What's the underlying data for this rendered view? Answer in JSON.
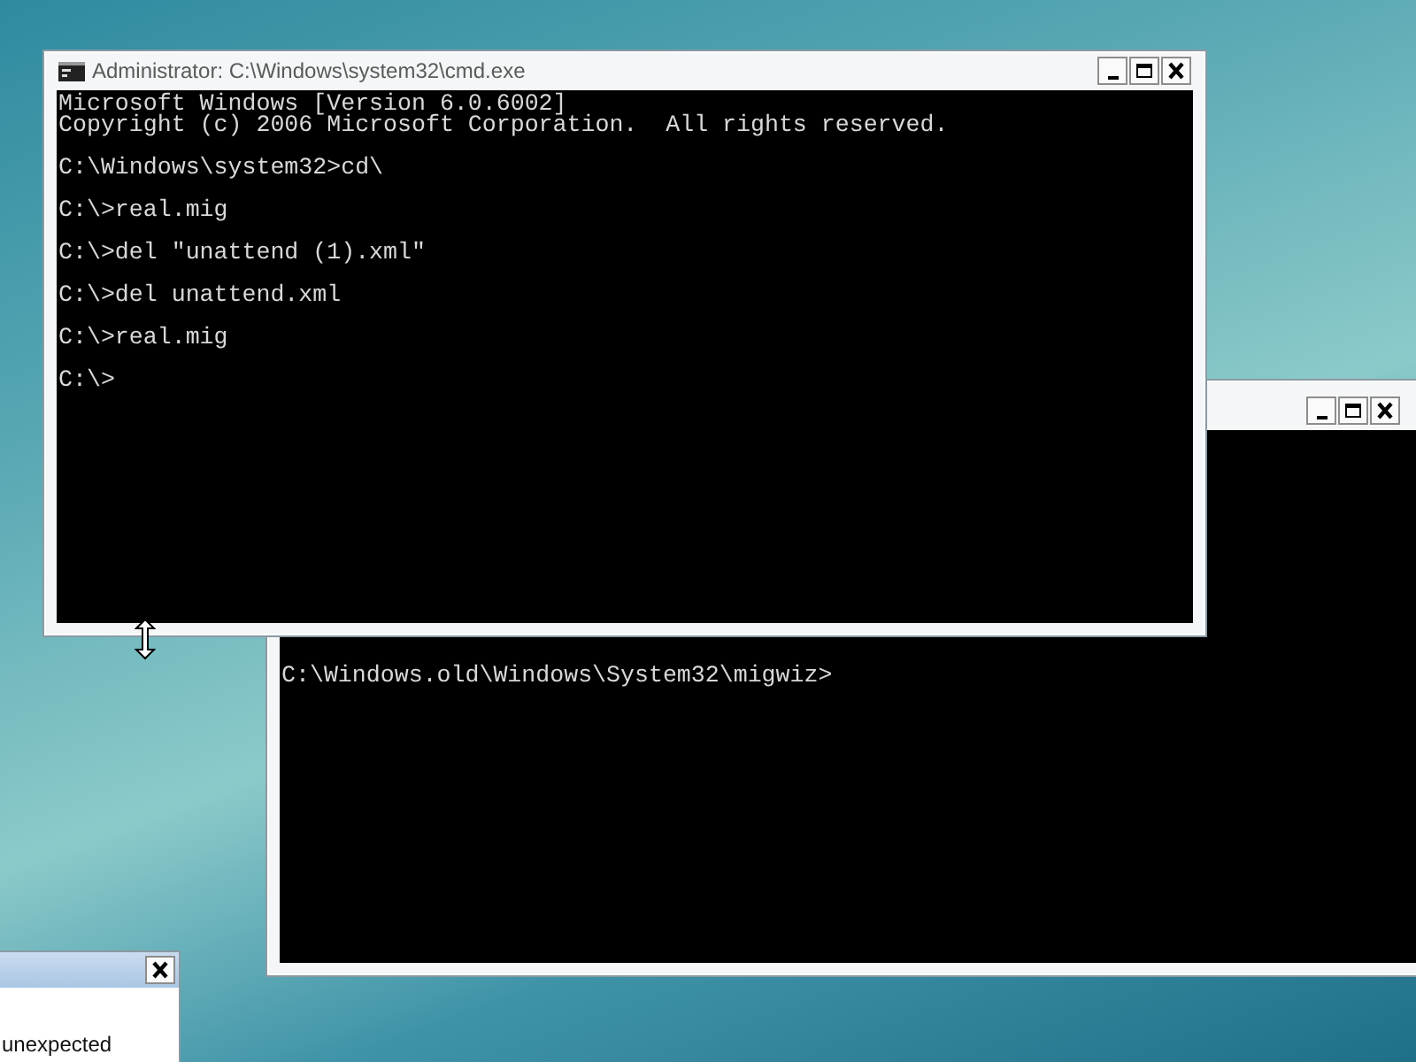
{
  "windows": [
    {
      "kind": "console",
      "title": "Administrator: C:\\Windows\\system32\\cmd.exe",
      "paragraphs": [
        [
          "Microsoft Windows [Version 6.0.6002]",
          "Copyright (c) 2006 Microsoft Corporation.  All rights reserved."
        ],
        [
          "C:\\Windows\\system32>cd\\"
        ],
        [
          "C:\\>real.mig"
        ],
        [
          "C:\\>del \"unattend (1).xml\""
        ],
        [
          "C:\\>del unattend.xml"
        ],
        [
          "C:\\>real.mig"
        ],
        [
          "C:\\>"
        ]
      ]
    },
    {
      "kind": "console",
      "paragraphs": [
        [
          "C:\\Windows.old\\Windows\\System32\\migwiz>"
        ]
      ]
    },
    {
      "kind": "dialog",
      "body": "unexpected"
    }
  ]
}
